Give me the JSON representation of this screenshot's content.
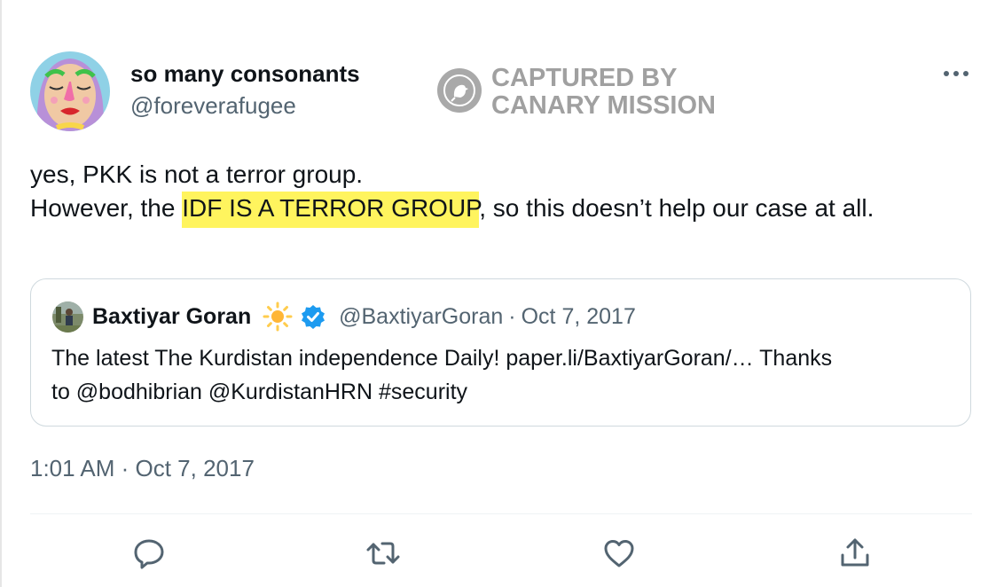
{
  "tweet": {
    "author_name": "so many consonants",
    "author_handle": "@foreverafugee",
    "text_line1": "yes, PKK is not a terror group.",
    "text_line2_before": "However, the ",
    "text_line2_highlight": "IDF IS A TERROR GROUP",
    "text_line2_after": ", so this doesn’t help our case at all.",
    "timestamp": "1:01 AM · Oct 7, 2017"
  },
  "watermark": {
    "line1": "CAPTURED BY",
    "line2": "CANARY MISSION"
  },
  "quoted_tweet": {
    "author_name": "Baxtiyar Goran",
    "author_handle": "@BaxtiyarGoran",
    "date": "Oct 7, 2017",
    "text_line1": "The latest The Kurdistan independence Daily! paper.li/BaxtiyarGoran/… Thanks",
    "text_line2": "to @bodhibrian @KurdistanHRN #security"
  },
  "actions": [
    "reply-icon",
    "retweet-icon",
    "like-icon",
    "share-icon"
  ],
  "colors": {
    "highlight": "#fff45e",
    "secondary_text": "#536471",
    "icon": "#536471",
    "verified": "#1d9bf0",
    "border": "#cfd9de"
  }
}
